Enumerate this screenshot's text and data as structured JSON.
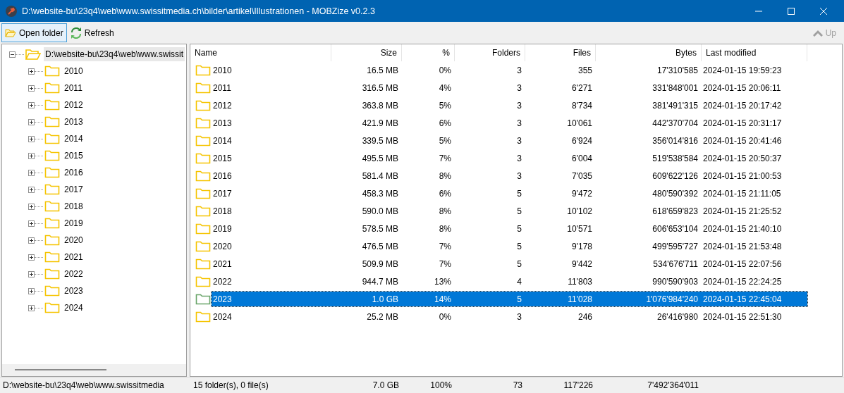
{
  "window": {
    "title": "D:\\website-bu\\23q4\\web\\www.swissitmedia.ch\\bilder\\artikel\\Illustrationen - MOBZize v0.2.3"
  },
  "toolbar": {
    "open_folder": "Open folder",
    "refresh": "Refresh",
    "up": "Up",
    "up_disabled": true
  },
  "tree": {
    "label": "D:\\website-bu\\23q4\\web\\www.swissit",
    "expanded": true,
    "selected": true,
    "children": [
      {
        "label": "2010",
        "expanded": false,
        "selected": false
      },
      {
        "label": "2011",
        "expanded": false,
        "selected": false
      },
      {
        "label": "2012",
        "expanded": false,
        "selected": false
      },
      {
        "label": "2013",
        "expanded": false,
        "selected": false
      },
      {
        "label": "2014",
        "expanded": false,
        "selected": false
      },
      {
        "label": "2015",
        "expanded": false,
        "selected": false
      },
      {
        "label": "2016",
        "expanded": false,
        "selected": false
      },
      {
        "label": "2017",
        "expanded": false,
        "selected": false
      },
      {
        "label": "2018",
        "expanded": false,
        "selected": false
      },
      {
        "label": "2019",
        "expanded": false,
        "selected": false
      },
      {
        "label": "2020",
        "expanded": false,
        "selected": false
      },
      {
        "label": "2021",
        "expanded": false,
        "selected": false
      },
      {
        "label": "2022",
        "expanded": false,
        "selected": false
      },
      {
        "label": "2023",
        "expanded": false,
        "selected": false
      },
      {
        "label": "2024",
        "expanded": false,
        "selected": false
      }
    ]
  },
  "table": {
    "columns": [
      "Name",
      "Size",
      "%",
      "Folders",
      "Files",
      "Bytes",
      "Last modified"
    ],
    "rows": [
      {
        "cells": [
          "2010",
          "16.5 MB",
          "0%",
          "3",
          "355",
          "17'310'585",
          "2024-01-15 19:59:23"
        ],
        "selected": false
      },
      {
        "cells": [
          "2011",
          "316.5 MB",
          "4%",
          "3",
          "6'271",
          "331'848'001",
          "2024-01-15 20:06:11"
        ],
        "selected": false
      },
      {
        "cells": [
          "2012",
          "363.8 MB",
          "5%",
          "3",
          "8'734",
          "381'491'315",
          "2024-01-15 20:17:42"
        ],
        "selected": false
      },
      {
        "cells": [
          "2013",
          "421.9 MB",
          "6%",
          "3",
          "10'061",
          "442'370'704",
          "2024-01-15 20:31:17"
        ],
        "selected": false
      },
      {
        "cells": [
          "2014",
          "339.5 MB",
          "5%",
          "3",
          "6'924",
          "356'014'816",
          "2024-01-15 20:41:46"
        ],
        "selected": false
      },
      {
        "cells": [
          "2015",
          "495.5 MB",
          "7%",
          "3",
          "6'004",
          "519'538'584",
          "2024-01-15 20:50:37"
        ],
        "selected": false
      },
      {
        "cells": [
          "2016",
          "581.4 MB",
          "8%",
          "3",
          "7'035",
          "609'622'126",
          "2024-01-15 21:00:53"
        ],
        "selected": false
      },
      {
        "cells": [
          "2017",
          "458.3 MB",
          "6%",
          "5",
          "9'472",
          "480'590'392",
          "2024-01-15 21:11:05"
        ],
        "selected": false
      },
      {
        "cells": [
          "2018",
          "590.0 MB",
          "8%",
          "5",
          "10'102",
          "618'659'823",
          "2024-01-15 21:25:52"
        ],
        "selected": false
      },
      {
        "cells": [
          "2019",
          "578.5 MB",
          "8%",
          "5",
          "10'571",
          "606'653'104",
          "2024-01-15 21:40:10"
        ],
        "selected": false
      },
      {
        "cells": [
          "2020",
          "476.5 MB",
          "7%",
          "5",
          "9'178",
          "499'595'727",
          "2024-01-15 21:53:48"
        ],
        "selected": false
      },
      {
        "cells": [
          "2021",
          "509.9 MB",
          "7%",
          "5",
          "9'442",
          "534'676'711",
          "2024-01-15 22:07:56"
        ],
        "selected": false
      },
      {
        "cells": [
          "2022",
          "944.7 MB",
          "13%",
          "4",
          "11'803",
          "990'590'903",
          "2024-01-15 22:24:25"
        ],
        "selected": false
      },
      {
        "cells": [
          "2023",
          "1.0 GB",
          "14%",
          "5",
          "11'028",
          "1'076'984'240",
          "2024-01-15 22:45:04"
        ],
        "selected": true
      },
      {
        "cells": [
          "2024",
          "25.2 MB",
          "0%",
          "3",
          "246",
          "26'416'980",
          "2024-01-15 22:51:30"
        ],
        "selected": false
      }
    ]
  },
  "status_bar": [
    "D:\\website-bu\\23q4\\web\\www.swissitmedia",
    "15 folder(s), 0 file(s)",
    "7.0 GB",
    "100%",
    "73",
    "117'226",
    "7'492'364'011"
  ]
}
